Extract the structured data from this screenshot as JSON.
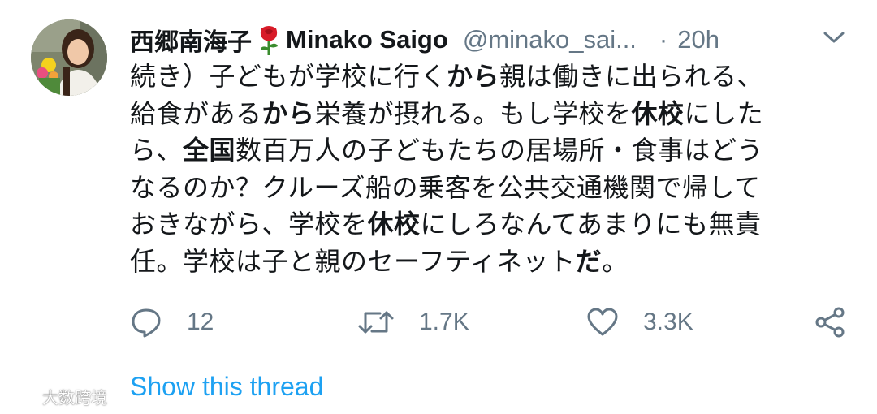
{
  "tweet": {
    "display_name": "西郷南海子",
    "name_emoji": "rose-icon",
    "handle_name": "Minako Saigo",
    "handle": "@minako_sai...",
    "separator": "·",
    "time": "20h",
    "body_lines": [
      [
        {
          "t": "続き）子どもが学校に行く",
          "b": false
        },
        {
          "t": "から",
          "b": true
        },
        {
          "t": "親は働きに出られる、",
          "b": false
        }
      ],
      [
        {
          "t": "給食がある",
          "b": false
        },
        {
          "t": "から",
          "b": true
        },
        {
          "t": "栄養が摂れる。もし学校を",
          "b": false
        },
        {
          "t": "休校",
          "b": true
        },
        {
          "t": "にした",
          "b": false
        }
      ],
      [
        {
          "t": "ら、",
          "b": false
        },
        {
          "t": "全国",
          "b": true
        },
        {
          "t": "数百万人の子どもたちの居場所・食事はどう",
          "b": false
        }
      ],
      [
        {
          "t": "なるのか？クルーズ船の乗客を公共交通機関で帰して",
          "b": false
        }
      ],
      [
        {
          "t": "おきながら、学校を",
          "b": false
        },
        {
          "t": "休校",
          "b": true
        },
        {
          "t": "にしろなんてあまりにも無責",
          "b": false
        }
      ],
      [
        {
          "t": "任。学校は子と親のセーフティネット",
          "b": false
        },
        {
          "t": "だ",
          "b": true
        },
        {
          "t": "。",
          "b": false
        }
      ]
    ],
    "actions": {
      "reply_count": "12",
      "retweet_count": "1.7K",
      "like_count": "3.3K"
    },
    "show_thread": "Show this thread"
  },
  "watermark": {
    "text": "大数跨境"
  },
  "colors": {
    "text": "#14171a",
    "secondary": "#657786",
    "link": "#1da1f2"
  }
}
